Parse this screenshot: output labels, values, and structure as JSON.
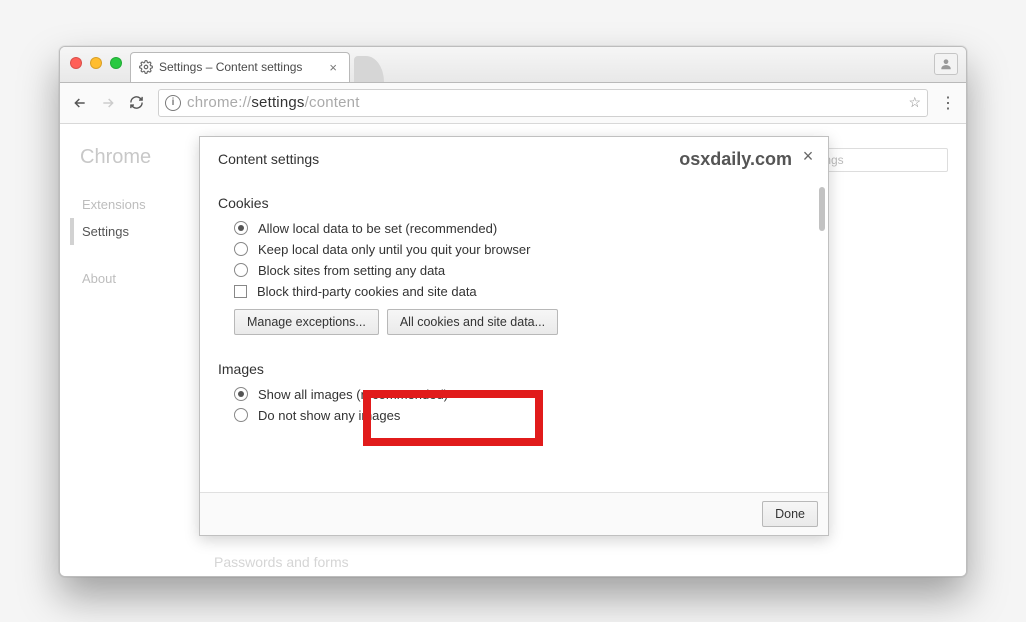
{
  "tab": {
    "title": "Settings – Content settings"
  },
  "url": {
    "prefix": "chrome://",
    "emph": "settings",
    "suffix": "/content"
  },
  "sidebar": {
    "brand": "Chrome",
    "items": [
      {
        "label": "Extensions"
      },
      {
        "label": "Settings"
      },
      {
        "label": "About"
      }
    ]
  },
  "search": {
    "placeholder": "ttings"
  },
  "dialog": {
    "title": "Content settings",
    "watermark": "osxdaily.com",
    "close": "×",
    "sections": {
      "cookies": {
        "title": "Cookies",
        "options": [
          "Allow local data to be set (recommended)",
          "Keep local data only until you quit your browser",
          "Block sites from setting any data"
        ],
        "checkbox": "Block third-party cookies and site data",
        "buttons": {
          "manage": "Manage exceptions...",
          "all_cookies": "All cookies and site data..."
        }
      },
      "images": {
        "title": "Images",
        "options": [
          "Show all images (recommended)",
          "Do not show any images"
        ]
      }
    },
    "done": "Done"
  },
  "ghost_section": "Passwords and forms"
}
